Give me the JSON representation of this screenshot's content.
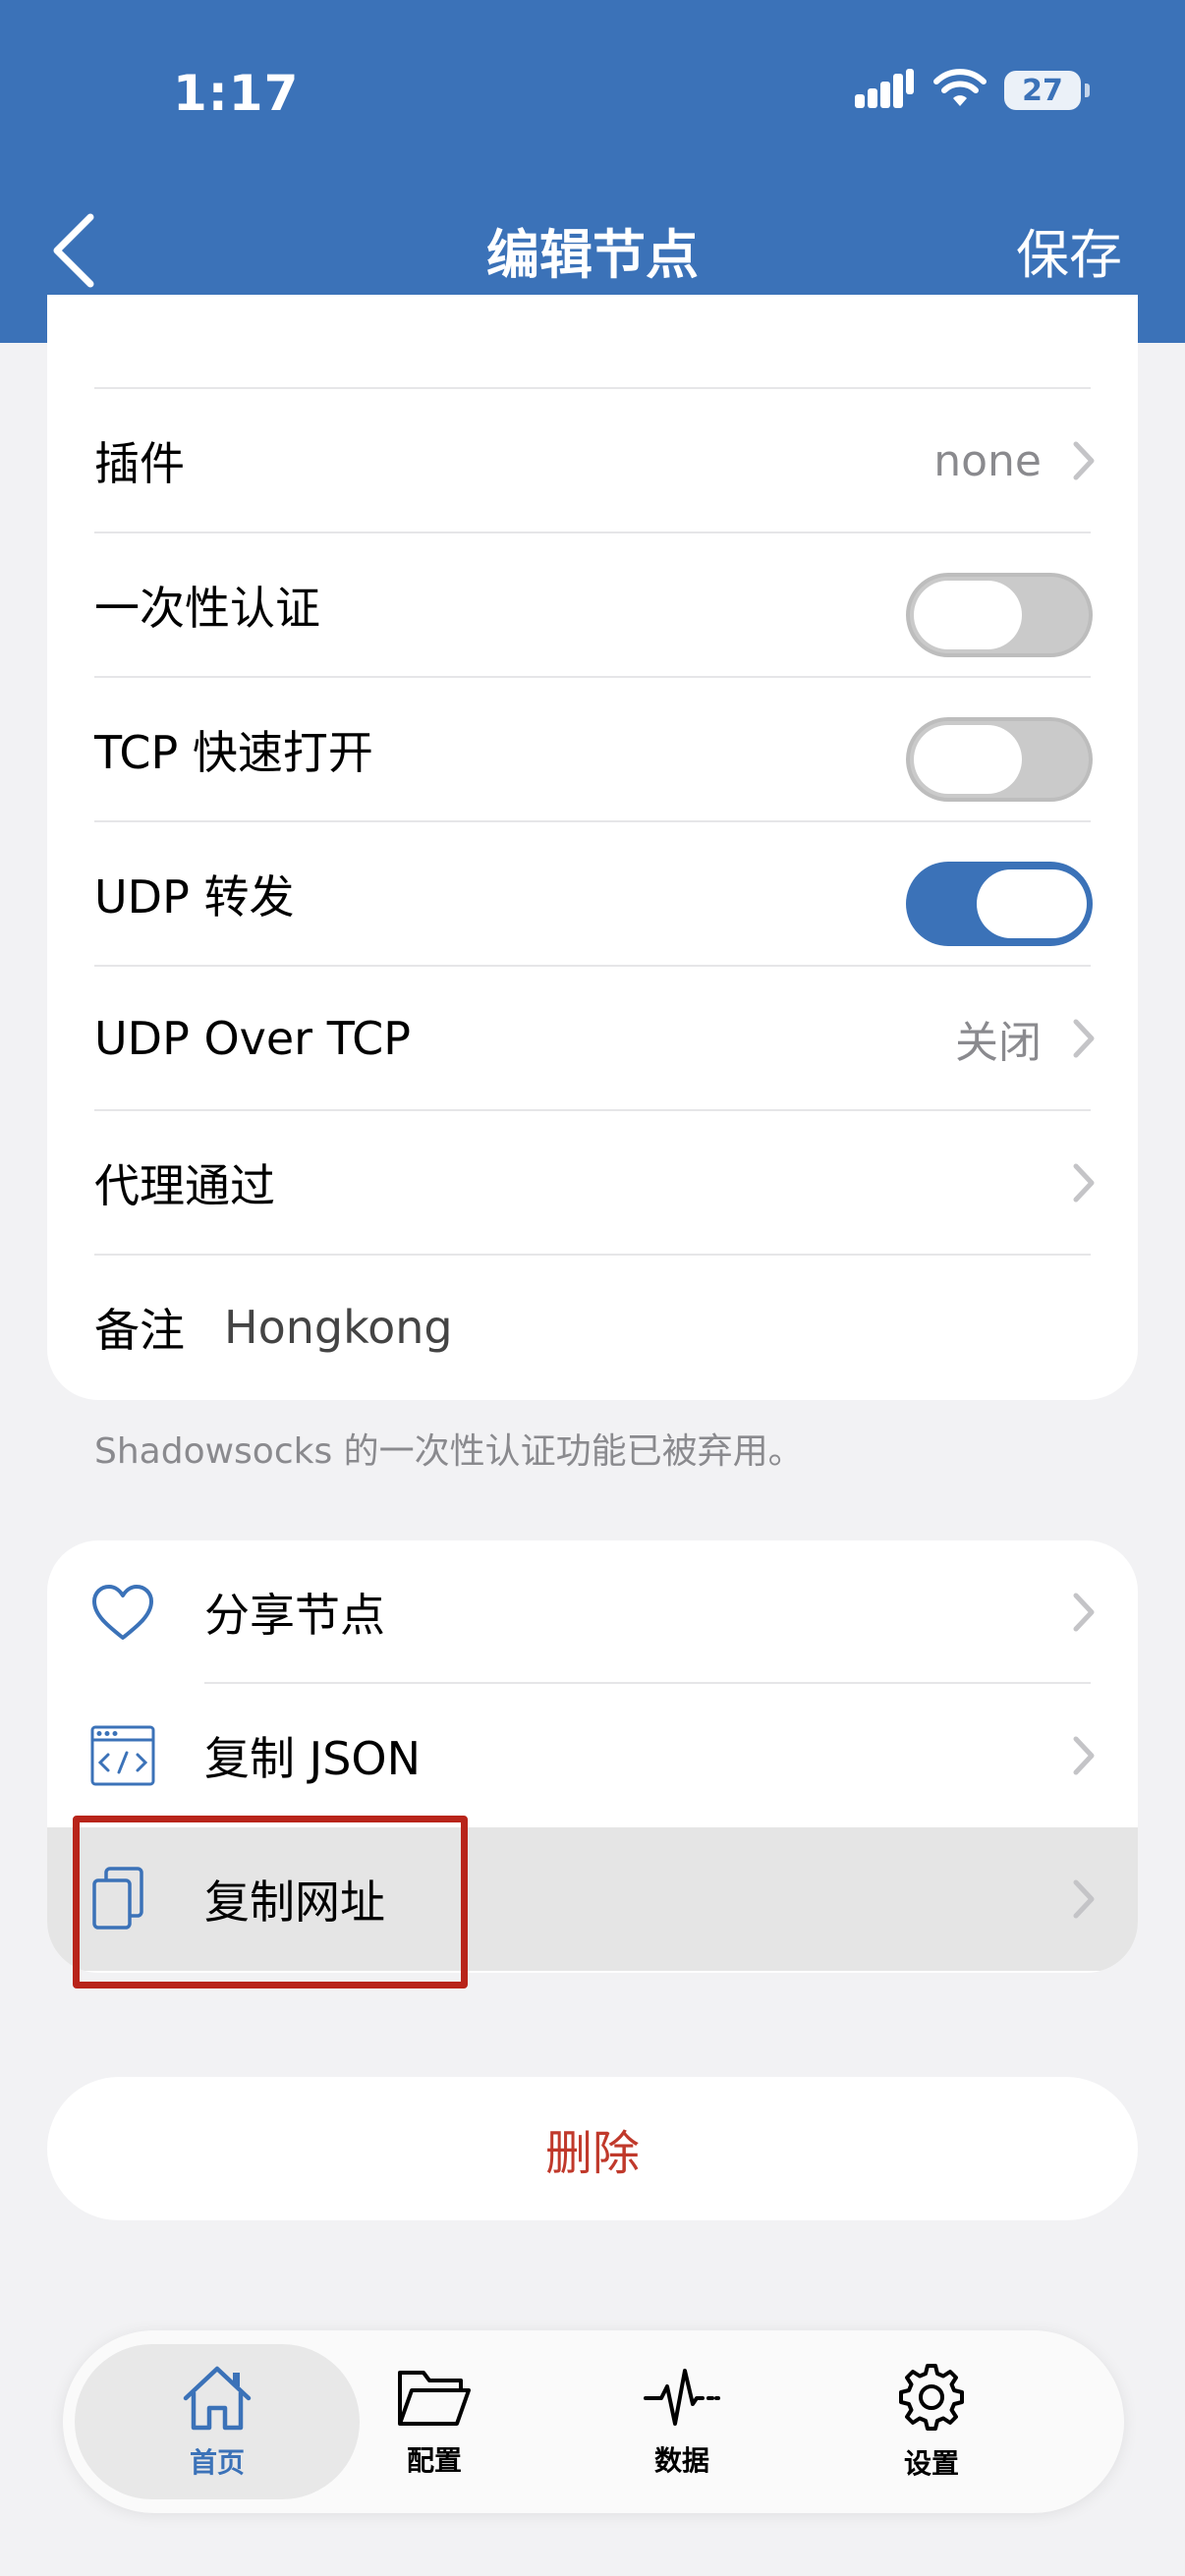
{
  "status_bar": {
    "time": "1:17",
    "battery": "27"
  },
  "nav": {
    "title": "编辑节点",
    "save": "保存"
  },
  "settings": {
    "plugin": {
      "label": "插件",
      "value": "none"
    },
    "one_time_auth": {
      "label": "一次性认证",
      "enabled": false
    },
    "tcp_fast_open": {
      "label": "TCP 快速打开",
      "enabled": false
    },
    "udp_relay": {
      "label": "UDP 转发",
      "enabled": true
    },
    "udp_over_tcp": {
      "label": "UDP Over TCP",
      "value": "关闭"
    },
    "proxy_via": {
      "label": "代理通过"
    },
    "note": {
      "label": "备注",
      "value": "Hongkong"
    }
  },
  "footnote": "Shadowsocks 的一次性认证功能已被弃用。",
  "actions": {
    "share": {
      "label": "分享节点",
      "icon": "heart-icon"
    },
    "copy_json": {
      "label": "复制 JSON",
      "icon": "code-window-icon"
    },
    "copy_url": {
      "label": "复制网址",
      "icon": "copy-icon"
    }
  },
  "delete": {
    "label": "删除"
  },
  "tabs": [
    {
      "label": "首页",
      "icon": "house-icon",
      "active": true
    },
    {
      "label": "配置",
      "icon": "folder-icon",
      "active": false
    },
    {
      "label": "数据",
      "icon": "pulse-icon",
      "active": false
    },
    {
      "label": "设置",
      "icon": "gear-icon",
      "active": false
    }
  ],
  "colors": {
    "accent": "#3b72b8",
    "danger": "#c0392b",
    "highlight_border": "#b8241a"
  }
}
